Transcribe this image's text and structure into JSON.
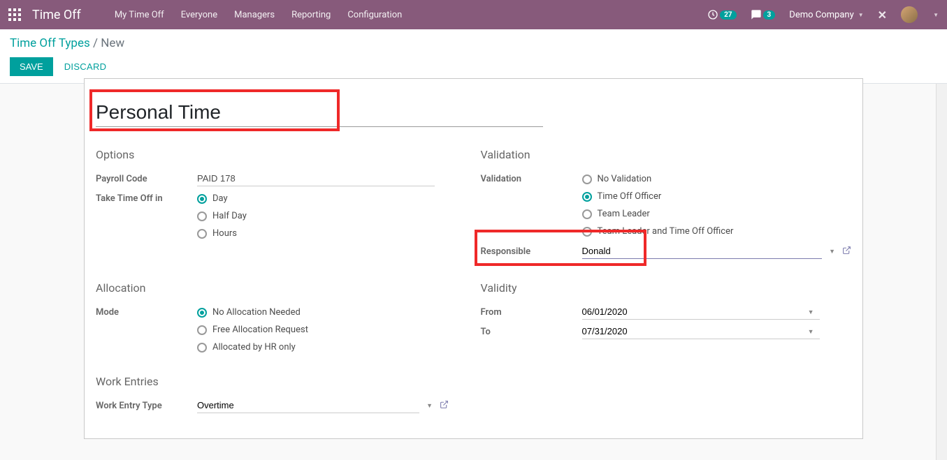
{
  "navbar": {
    "brand": "Time Off",
    "menu": [
      "My Time Off",
      "Everyone",
      "Managers",
      "Reporting",
      "Configuration"
    ],
    "activity_count": "27",
    "message_count": "3",
    "company": "Demo Company"
  },
  "breadcrumb": {
    "parent": "Time Off Types",
    "current": "New"
  },
  "actions": {
    "save": "SAVE",
    "discard": "DISCARD"
  },
  "form": {
    "title": "Personal Time",
    "options": {
      "section": "Options",
      "payroll_code_label": "Payroll Code",
      "payroll_code_value": "PAID 178",
      "take_off_label": "Take Time Off in",
      "take_off_options": [
        "Day",
        "Half Day",
        "Hours"
      ],
      "take_off_selected": "Day"
    },
    "validation": {
      "section": "Validation",
      "validation_label": "Validation",
      "validation_options": [
        "No Validation",
        "Time Off Officer",
        "Team Leader",
        "Team Leader and Time Off Officer"
      ],
      "validation_selected": "Time Off Officer",
      "responsible_label": "Responsible",
      "responsible_value": "Donald"
    },
    "allocation": {
      "section": "Allocation",
      "mode_label": "Mode",
      "mode_options": [
        "No Allocation Needed",
        "Free Allocation Request",
        "Allocated by HR only"
      ],
      "mode_selected": "No Allocation Needed"
    },
    "validity": {
      "section": "Validity",
      "from_label": "From",
      "from_value": "06/01/2020",
      "to_label": "To",
      "to_value": "07/31/2020"
    },
    "work_entries": {
      "section": "Work Entries",
      "type_label": "Work Entry Type",
      "type_value": "Overtime"
    }
  }
}
